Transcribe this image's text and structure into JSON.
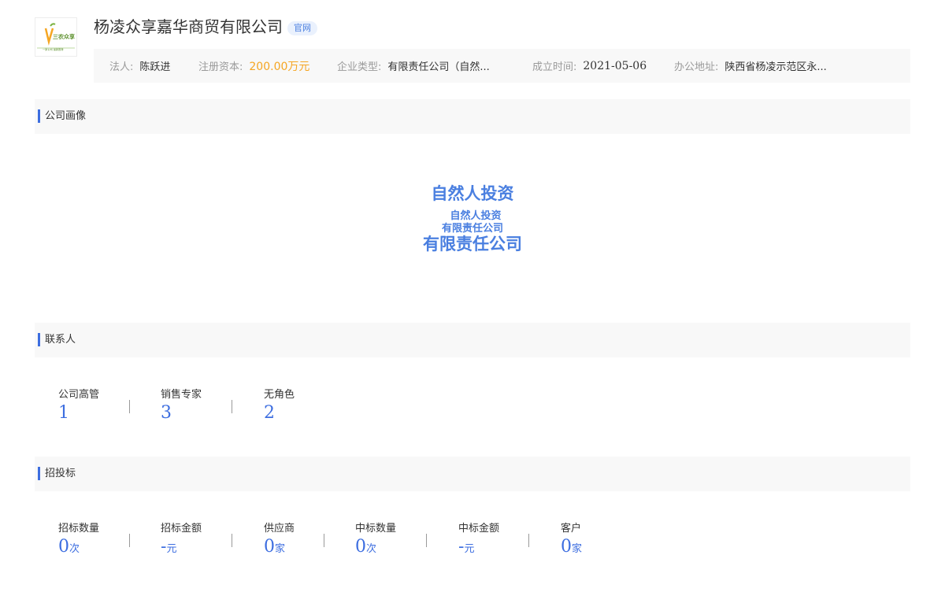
{
  "company": {
    "name": "杨凌众享嘉华商贸有限公司",
    "official_badge": "官网",
    "logo_text": "三农众享",
    "logo_slogan": "一家公司 最新推荐"
  },
  "info_bar": {
    "legal_rep_label": "法人:",
    "legal_rep_value": "陈跃进",
    "capital_label": "注册资本:",
    "capital_value": "200.00万元",
    "type_label": "企业类型:",
    "type_value": "有限责任公司（自然...",
    "founded_label": "成立时间:",
    "founded_value": "2021-05-06",
    "address_label": "办公地址:",
    "address_value": "陕西省杨凌示范区永..."
  },
  "sections": {
    "portrait": "公司画像",
    "contacts": "联系人",
    "bidding": "招投标"
  },
  "portrait_tags": [
    "自然人投资",
    "自然人投资",
    "有限责任公司",
    "有限责任公司"
  ],
  "contacts": [
    {
      "label": "公司高管",
      "value": "1"
    },
    {
      "label": "销售专家",
      "value": "3"
    },
    {
      "label": "无角色",
      "value": "2"
    }
  ],
  "bidding": [
    {
      "label": "招标数量",
      "value": "0",
      "unit": "次"
    },
    {
      "label": "招标金额",
      "value": "-",
      "unit": "元"
    },
    {
      "label": "供应商",
      "value": "0",
      "unit": "家"
    },
    {
      "label": "中标数量",
      "value": "0",
      "unit": "次"
    },
    {
      "label": "中标金额",
      "value": "-",
      "unit": "元"
    },
    {
      "label": "客户",
      "value": "0",
      "unit": "家"
    }
  ],
  "colors": {
    "accent": "#3d6ee0",
    "money": "#f5a623",
    "panel": "#f8f8f8"
  }
}
